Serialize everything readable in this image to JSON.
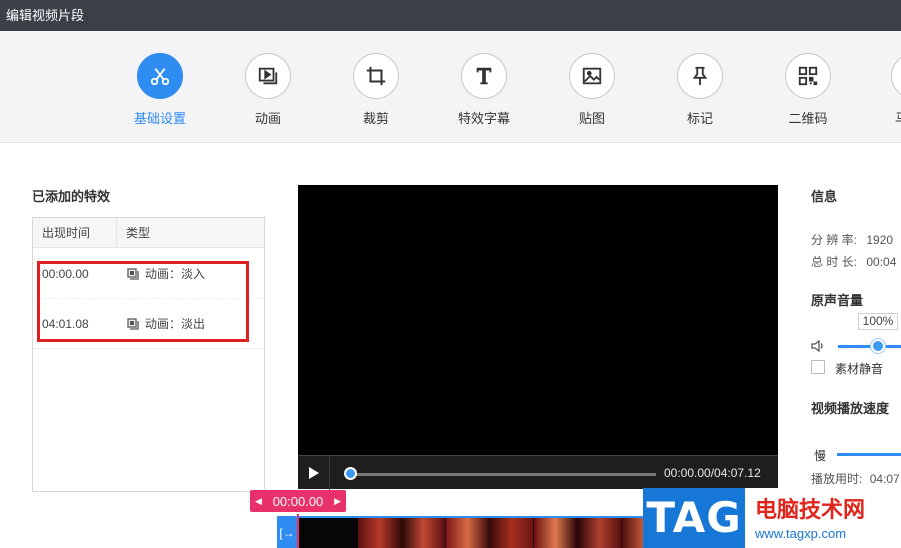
{
  "window": {
    "title": "编辑视频片段"
  },
  "toolbar": {
    "items": [
      {
        "label": "基础设置",
        "icon": "scissors-icon",
        "active": true
      },
      {
        "label": "动画",
        "icon": "animation-icon",
        "active": false
      },
      {
        "label": "裁剪",
        "icon": "crop-icon",
        "active": false
      },
      {
        "label": "特效字幕",
        "icon": "text-icon",
        "active": false
      },
      {
        "label": "贴图",
        "icon": "image-icon",
        "active": false
      },
      {
        "label": "标记",
        "icon": "pin-icon",
        "active": false
      },
      {
        "label": "二维码",
        "icon": "qrcode-icon",
        "active": false
      },
      {
        "label": "马",
        "icon": "mosaic-icon",
        "active": false
      }
    ]
  },
  "effects": {
    "title": "已添加的特效",
    "columns": [
      "出现时间",
      "类型"
    ],
    "rows": [
      {
        "time": "00:00.00",
        "type": "动画：淡入"
      },
      {
        "time": "04:01.08",
        "type": "动画：淡出"
      }
    ]
  },
  "player": {
    "timecode": "00:00.00/04:07.12"
  },
  "timeline": {
    "current_time": "00:00.00"
  },
  "info": {
    "title": "信息",
    "resolution_label": "分 辨 率:",
    "resolution_value": "1920",
    "duration_label": "总 时 长:",
    "duration_value": "00:04",
    "volume_title": "原声音量",
    "volume_value": "100%",
    "mute_label": "素材静音",
    "speed_title": "视频播放速度",
    "speed_slow": "慢",
    "playtime_label": "播放用时:",
    "playtime_value": "04:07"
  },
  "watermark": {
    "logo": "TAG",
    "site_name": "电脑技术网",
    "url": "www.tagxp.com"
  },
  "colors": {
    "accent": "#2f8cf0",
    "titlebar": "#3b3f47",
    "time_flag": "#e8306a",
    "highlight": "#e02020"
  }
}
